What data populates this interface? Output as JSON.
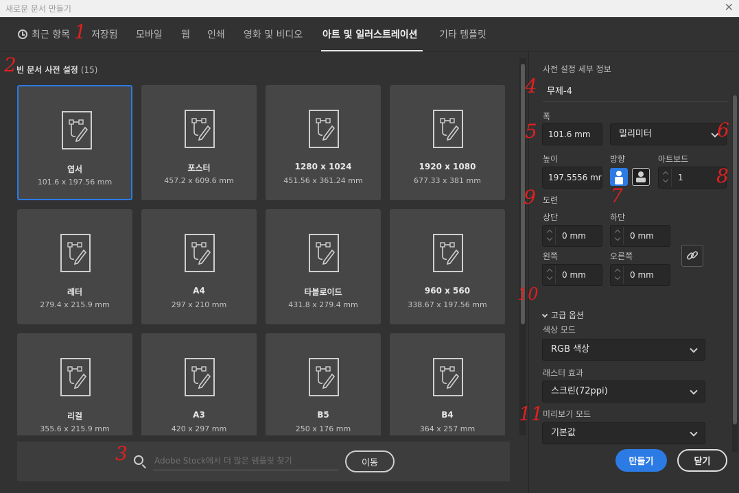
{
  "window": {
    "title": "새로운 문서 만들기",
    "close_glyph": "✕"
  },
  "tabs": [
    {
      "label": "최근 항목"
    },
    {
      "label": "저장됨"
    },
    {
      "label": "모바일"
    },
    {
      "label": "웹"
    },
    {
      "label": "인쇄"
    },
    {
      "label": "영화 및 비디오"
    },
    {
      "label": "아트 및 일러스트레이션",
      "active": true
    },
    {
      "label": "기타 템플릿"
    }
  ],
  "annotations": [
    "1",
    "2",
    "3",
    "4",
    "5",
    "6",
    "7",
    "8",
    "9",
    "10",
    "11"
  ],
  "presets": {
    "title": "빈 문서 사전 설정",
    "count": "(15)",
    "items": [
      {
        "name": "엽서",
        "size": "101.6 x 197.56 mm",
        "selected": true
      },
      {
        "name": "포스터",
        "size": "457.2 x 609.6 mm"
      },
      {
        "name": "1280 x 1024",
        "size": "451.56 x 361.24 mm"
      },
      {
        "name": "1920 x 1080",
        "size": "677.33 x 381 mm"
      },
      {
        "name": "레터",
        "size": "279.4 x 215.9 mm"
      },
      {
        "name": "A4",
        "size": "297 x 210 mm"
      },
      {
        "name": "타블로이드",
        "size": "431.8 x 279.4 mm"
      },
      {
        "name": "960 x 560",
        "size": "338.67 x 197.56 mm"
      },
      {
        "name": "리걸",
        "size": "355.6 x 215.9 mm"
      },
      {
        "name": "A3",
        "size": "420 x 297 mm"
      },
      {
        "name": "B5",
        "size": "250 x 176 mm"
      },
      {
        "name": "B4",
        "size": "364 x 257 mm"
      }
    ]
  },
  "search": {
    "placeholder": "Adobe Stock에서 더 많은 템플릿 찾기",
    "go_label": "이동"
  },
  "details": {
    "heading": "사전 설정 세부 정보",
    "doc_name": "무제-4",
    "width_label": "폭",
    "width_value": "101.6 mm",
    "unit_value": "밀리미터",
    "height_label": "높이",
    "height_value": "197.5556 mr",
    "orientation_label": "방향",
    "artboards_label": "아트보드",
    "artboards_value": "1",
    "bleed_label": "도련",
    "bleed_top_label": "상단",
    "bleed_top_value": "0 mm",
    "bleed_bottom_label": "하단",
    "bleed_bottom_value": "0 mm",
    "bleed_left_label": "왼쪽",
    "bleed_left_value": "0 mm",
    "bleed_right_label": "오른쪽",
    "bleed_right_value": "0 mm",
    "advanced_label": "고급 옵션",
    "color_mode_label": "색상 모드",
    "color_mode_value": "RGB 색상",
    "raster_label": "래스터 효과",
    "raster_value": "스크린(72ppi)",
    "preview_label": "미리보기 모드",
    "preview_value": "기본값"
  },
  "footer": {
    "create_label": "만들기",
    "close_label": "닫기"
  },
  "colors": {
    "accent": "#2c7be5",
    "annotation": "#e02020",
    "panel": "#323232",
    "card": "#464646"
  }
}
